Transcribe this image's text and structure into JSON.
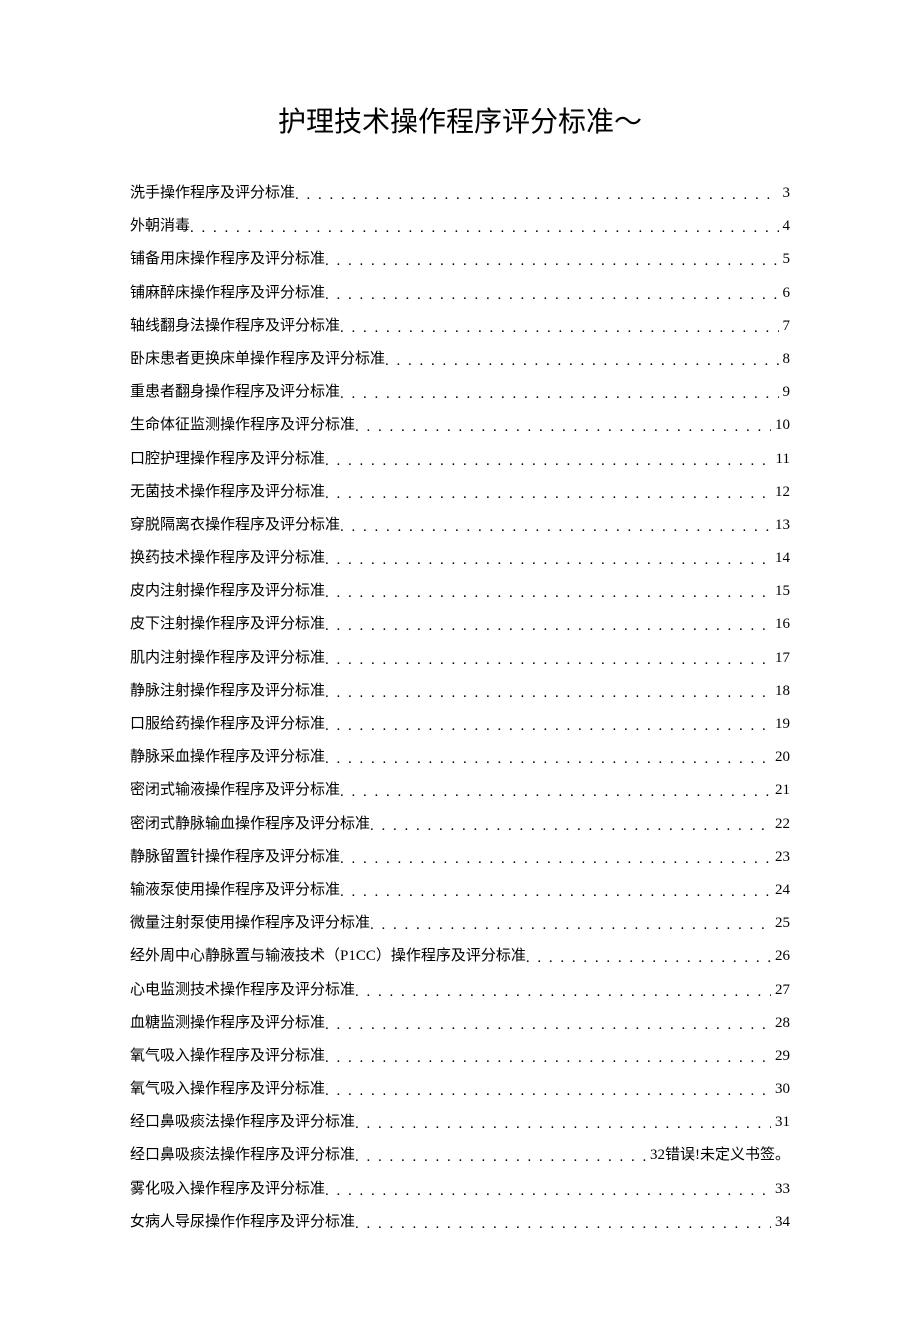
{
  "title": "护理技术操作程序评分标准～",
  "toc": [
    {
      "label": "洗手操作程序及评分标准",
      "page": "3"
    },
    {
      "label": "外朝消毒",
      "page": "4"
    },
    {
      "label": "铺备用床操作程序及评分标准",
      "page": "5"
    },
    {
      "label": "铺麻醉床操作程序及评分标准",
      "page": "6"
    },
    {
      "label": "轴线翻身法操作程序及评分标准",
      "page": "7"
    },
    {
      "label": "卧床患者更换床单操作程序及评分标准",
      "page": "8"
    },
    {
      "label": "重患者翻身操作程序及评分标准",
      "page": "9"
    },
    {
      "label": "生命体征监测操作程序及评分标准",
      "page": "10"
    },
    {
      "label": "口腔护理操作程序及评分标准",
      "page": "11"
    },
    {
      "label": "无菌技术操作程序及评分标准",
      "page": "12"
    },
    {
      "label": "穿脱隔离衣操作程序及评分标准",
      "page": "13"
    },
    {
      "label": "换药技术操作程序及评分标准",
      "page": "14"
    },
    {
      "label": "皮内注射操作程序及评分标准",
      "page": "15"
    },
    {
      "label": "皮下注射操作程序及评分标准",
      "page": "16"
    },
    {
      "label": "肌内注射操作程序及评分标准",
      "page": "17"
    },
    {
      "label": "静脉注射操作程序及评分标准",
      "page": "18"
    },
    {
      "label": "口服给药操作程序及评分标准",
      "page": "19"
    },
    {
      "label": "静脉采血操作程序及评分标准",
      "page": "20"
    },
    {
      "label": "密闭式输液操作程序及评分标准",
      "page": "21"
    },
    {
      "label": "密闭式静脉输血操作程序及评分标准",
      "page": "22"
    },
    {
      "label": "静脉留置针操作程序及评分标准",
      "page": "23"
    },
    {
      "label": "输液泵使用操作程序及评分标准",
      "page": "24"
    },
    {
      "label": "微量注射泵使用操作程序及评分标准",
      "page": "25"
    },
    {
      "label": "经外周中心静脉置与输液技术（P1CC）操作程序及评分标准",
      "page": "26"
    },
    {
      "label": "心电监测技术操作程序及评分标准",
      "page": "27"
    },
    {
      "label": "血糖监测操作程序及评分标准",
      "page": "28"
    },
    {
      "label": "氧气吸入操作程序及评分标准",
      "page": "29"
    },
    {
      "label": "氧气吸入操作程序及评分标准",
      "page": "30"
    },
    {
      "label": "经口鼻吸痰法操作程序及评分标准",
      "page": "31"
    },
    {
      "label": "经口鼻吸痰法操作程序及评分标准",
      "page": "32",
      "suffix": " 错误!未定义书签。"
    },
    {
      "label": "雾化吸入操作程序及评分标准",
      "page": "33"
    },
    {
      "label": "女病人导尿操作作程序及评分标准",
      "page": "34"
    }
  ]
}
